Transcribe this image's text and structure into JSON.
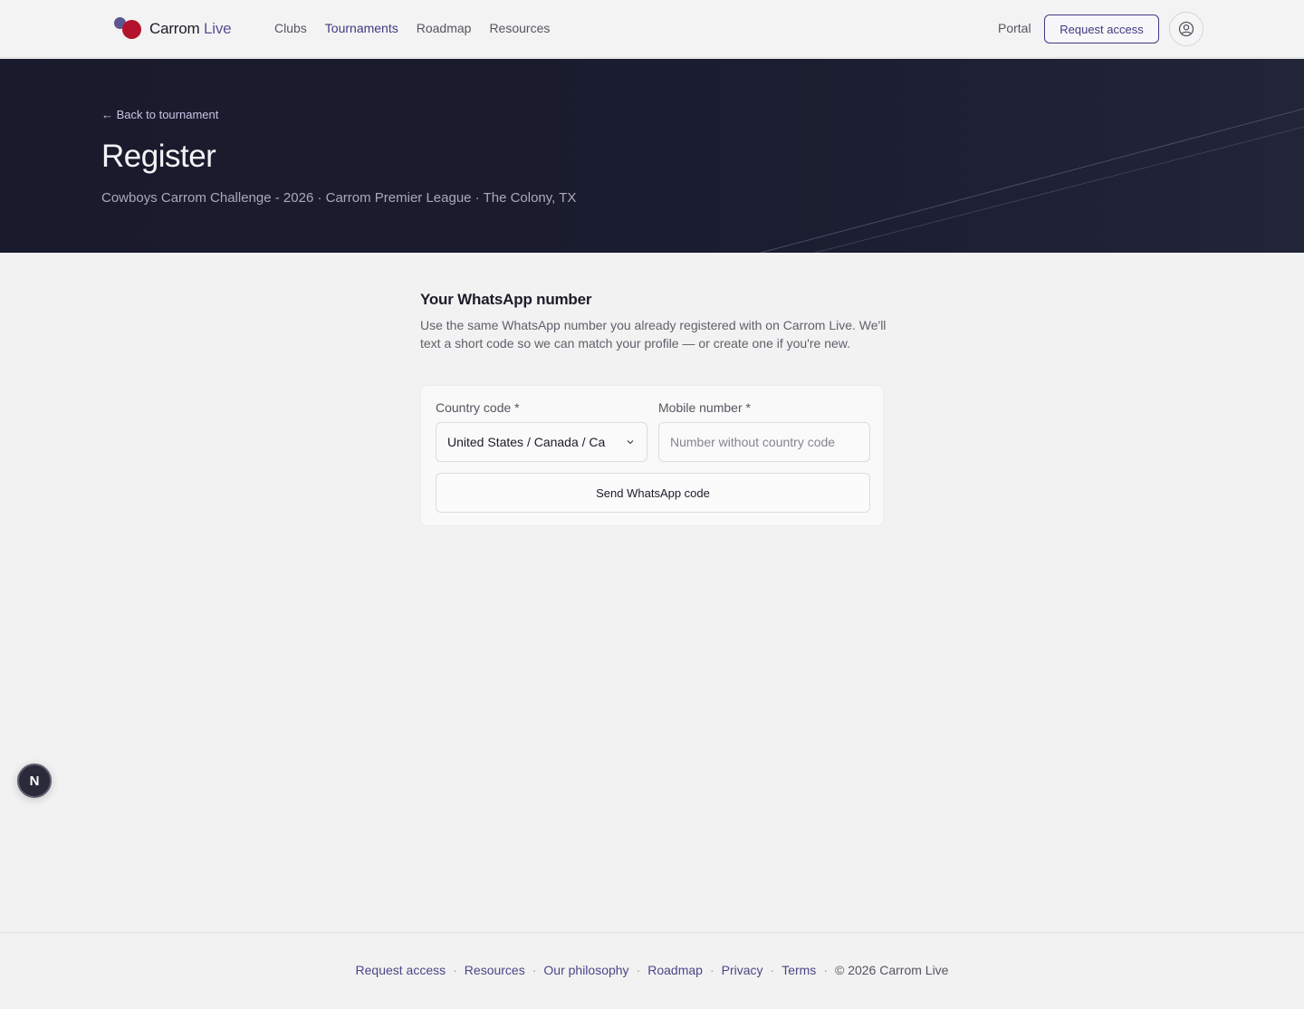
{
  "header": {
    "brand_main": "Carrom",
    "brand_accent": "Live",
    "nav": [
      {
        "label": "Clubs",
        "active": false
      },
      {
        "label": "Tournaments",
        "active": true
      },
      {
        "label": "Roadmap",
        "active": false
      },
      {
        "label": "Resources",
        "active": false
      }
    ],
    "portal_label": "Portal",
    "request_access_label": "Request access",
    "user_icon": "user-circle-icon"
  },
  "hero": {
    "back_label": "← Back to tournament",
    "title": "Register",
    "subtitle": "Cowboys Carrom Challenge - 2026 · Carrom Premier League · The Colony, TX"
  },
  "form": {
    "title": "Your WhatsApp number",
    "description": "Use the same WhatsApp number you already registered with on Carrom Live. We'll text a short code so we can match your profile — or create one if you're new.",
    "country_label": "Country code *",
    "country_value": "United States / Canada / Ca",
    "mobile_label": "Mobile number *",
    "mobile_placeholder": "Number without country code",
    "mobile_value": "",
    "send_button": "Send WhatsApp code"
  },
  "badge": {
    "letter": "N"
  },
  "footer": {
    "links": [
      "Request access",
      "Resources",
      "Our philosophy",
      "Roadmap",
      "Privacy",
      "Terms"
    ],
    "separator": "·",
    "copyright": "© 2026 Carrom Live"
  },
  "colors": {
    "accent": "#3f3a82",
    "brand_red": "#b3132b",
    "brand_purple": "#5b568f",
    "hero_bg": "#1b1d30",
    "page_bg": "#f2f2f2"
  }
}
